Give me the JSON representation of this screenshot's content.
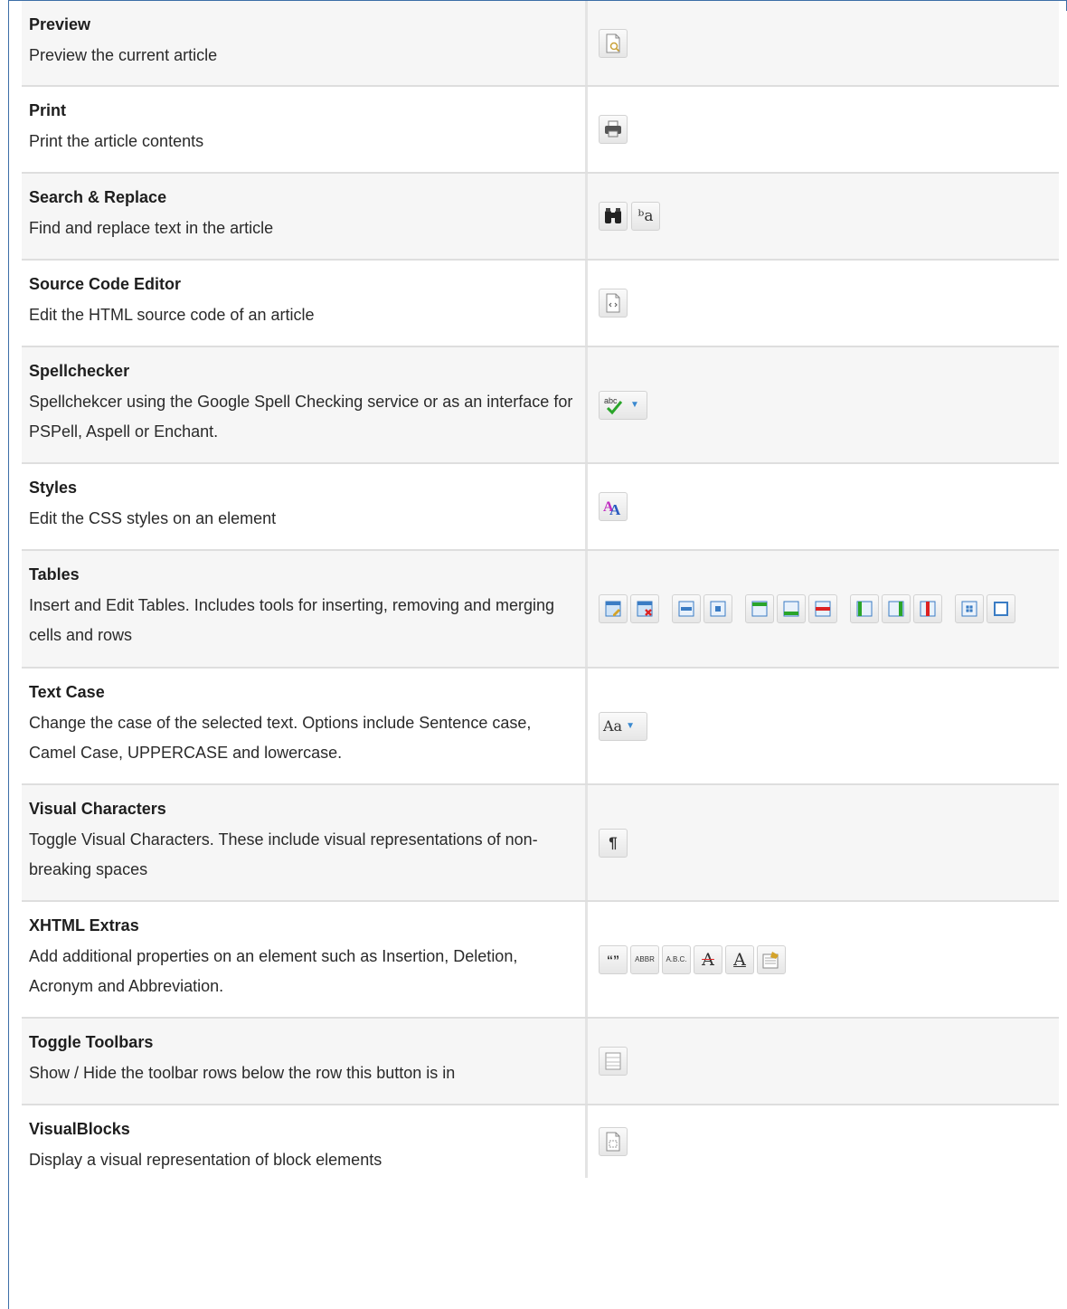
{
  "rows": [
    {
      "name": "Preview",
      "desc": "Preview the current article",
      "icons": [
        "preview-icon"
      ]
    },
    {
      "name": "Print",
      "desc": "Print the article contents",
      "icons": [
        "printer-icon"
      ]
    },
    {
      "name": "Search & Replace",
      "desc": "Find and replace text in the article",
      "icons": [
        "binoculars-icon",
        "replace-icon"
      ]
    },
    {
      "name": "Source Code Editor",
      "desc": "Edit the HTML source code of an article",
      "icons": [
        "source-code-icon"
      ]
    },
    {
      "name": "Spellchecker",
      "desc": "Spellchekcer using the Google Spell Checking service or as an interface for PSPell, Aspell or Enchant.",
      "icons": [
        "spellcheck-icon"
      ]
    },
    {
      "name": "Styles",
      "desc": "Edit the CSS styles on an element",
      "icons": [
        "styles-icon"
      ]
    },
    {
      "name": "Tables",
      "desc": "Insert and Edit Tables. Includes tools for inserting, removing and merging cells and rows",
      "icons": [
        "table-insert-icon",
        "table-delete-icon",
        "table-row-props-icon",
        "table-cell-props-icon",
        "row-before-icon",
        "row-after-icon",
        "delete-row-icon",
        "col-before-icon",
        "col-after-icon",
        "delete-col-icon",
        "split-cells-icon",
        "merge-cells-icon"
      ]
    },
    {
      "name": "Text Case",
      "desc": "Change the case of the selected text. Options include Sentence case, Camel Case, UPPERCASE and lowercase.",
      "icons": [
        "text-case-icon"
      ]
    },
    {
      "name": "Visual Characters",
      "desc": "Toggle Visual Characters. These include visual representations of non-breaking spaces",
      "icons": [
        "pilcrow-icon"
      ]
    },
    {
      "name": "XHTML Extras",
      "desc": "Add additional properties on an element such as Insertion, Deletion, Acronym and Abbreviation.",
      "icons": [
        "cite-icon",
        "abbr-icon",
        "acronym-icon",
        "deletion-icon",
        "insertion-icon",
        "attributes-icon"
      ]
    },
    {
      "name": "Toggle Toolbars",
      "desc": "Show / Hide the toolbar rows below the row this button is in",
      "icons": [
        "toggle-toolbars-icon"
      ]
    },
    {
      "name": "VisualBlocks",
      "desc": "Display a visual representation of block elements",
      "icons": [
        "visual-blocks-icon"
      ]
    }
  ],
  "icon_glyphs": {
    "replace_glyph": "ᵇa",
    "spell_glyph": "abc",
    "case_glyph": "Aa",
    "pilcrow_glyph": "¶",
    "cite_glyph": "“”",
    "abbr_glyph": "ABBR",
    "acronym_glyph": "A.B.C.",
    "deletion_glyph": "A",
    "insertion_glyph": "A",
    "styles_glyph": "A"
  },
  "colors": {
    "frame": "#3c6ea7",
    "row_alt": "#f6f6f6",
    "separator": "#dedede",
    "dropdown_caret": "#3a89d0"
  }
}
